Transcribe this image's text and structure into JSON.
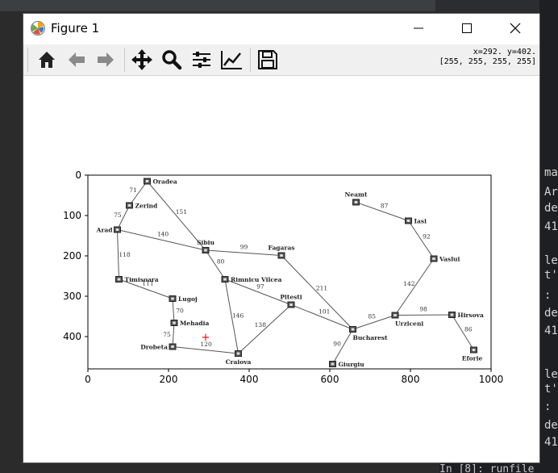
{
  "window": {
    "title": "Figure 1"
  },
  "toolbar": {
    "buttons": [
      "home-icon",
      "back-arrow-icon",
      "forward-arrow-icon",
      "pan-icon",
      "zoom-icon",
      "configure-subplots-icon",
      "edit-axis-icon",
      "save-icon"
    ],
    "coords_line1": "x=292. y=402.",
    "coords_line2": "[255, 255, 255, 255]"
  },
  "background_code": {
    "lines": [
      "ma",
      "Ar",
      "de",
      "41",
      "le",
      "t')",
      ": A",
      "de",
      "41",
      "le",
      "t')",
      ": A",
      "de",
      "41"
    ],
    "bottom": "In [8]: runfile"
  },
  "chart_data": {
    "type": "scatter",
    "description_kind": "romania map image shown with imshow",
    "xlim": [
      0,
      1000
    ],
    "ylim": [
      480,
      0
    ],
    "xticks": [
      0,
      200,
      400,
      600,
      800,
      1000
    ],
    "yticks": [
      0,
      100,
      200,
      300,
      400
    ],
    "cities": [
      {
        "name": "Oradea",
        "x": 147,
        "y": 15
      },
      {
        "name": "Zerind",
        "x": 103,
        "y": 75
      },
      {
        "name": "Arad",
        "x": 73,
        "y": 135
      },
      {
        "name": "Timisoara",
        "x": 77,
        "y": 258
      },
      {
        "name": "Lugoj",
        "x": 210,
        "y": 306
      },
      {
        "name": "Mehadia",
        "x": 214,
        "y": 366
      },
      {
        "name": "Drobeta",
        "x": 210,
        "y": 425
      },
      {
        "name": "Craiova",
        "x": 373,
        "y": 442
      },
      {
        "name": "Sibiu",
        "x": 292,
        "y": 186
      },
      {
        "name": "Rimnicu Vilcea",
        "x": 340,
        "y": 258
      },
      {
        "name": "Fagaras",
        "x": 480,
        "y": 199
      },
      {
        "name": "Pitesti",
        "x": 504,
        "y": 321
      },
      {
        "name": "Bucharest",
        "x": 657,
        "y": 382
      },
      {
        "name": "Giurgiu",
        "x": 607,
        "y": 468
      },
      {
        "name": "Urziceni",
        "x": 762,
        "y": 347
      },
      {
        "name": "Hirsova",
        "x": 903,
        "y": 346
      },
      {
        "name": "Eforie",
        "x": 957,
        "y": 433
      },
      {
        "name": "Vaslui",
        "x": 858,
        "y": 207
      },
      {
        "name": "Iasi",
        "x": 795,
        "y": 113
      },
      {
        "name": "Neamt",
        "x": 665,
        "y": 67
      }
    ],
    "roads": [
      {
        "a": "Oradea",
        "b": "Zerind",
        "d": "71"
      },
      {
        "a": "Zerind",
        "b": "Arad",
        "d": "75"
      },
      {
        "a": "Arad",
        "b": "Sibiu",
        "d": "140"
      },
      {
        "a": "Oradea",
        "b": "Sibiu",
        "d": "151"
      },
      {
        "a": "Arad",
        "b": "Timisoara",
        "d": "118"
      },
      {
        "a": "Timisoara",
        "b": "Lugoj",
        "d": "111"
      },
      {
        "a": "Lugoj",
        "b": "Mehadia",
        "d": "70"
      },
      {
        "a": "Mehadia",
        "b": "Drobeta",
        "d": "75"
      },
      {
        "a": "Drobeta",
        "b": "Craiova",
        "d": "120"
      },
      {
        "a": "Sibiu",
        "b": "Fagaras",
        "d": "99"
      },
      {
        "a": "Sibiu",
        "b": "Rimnicu Vilcea",
        "d": "80"
      },
      {
        "a": "Rimnicu Vilcea",
        "b": "Pitesti",
        "d": "97"
      },
      {
        "a": "Rimnicu Vilcea",
        "b": "Craiova",
        "d": "146"
      },
      {
        "a": "Craiova",
        "b": "Pitesti",
        "d": "138"
      },
      {
        "a": "Pitesti",
        "b": "Bucharest",
        "d": "101"
      },
      {
        "a": "Fagaras",
        "b": "Bucharest",
        "d": "211"
      },
      {
        "a": "Bucharest",
        "b": "Giurgiu",
        "d": "90"
      },
      {
        "a": "Bucharest",
        "b": "Urziceni",
        "d": "85"
      },
      {
        "a": "Urziceni",
        "b": "Hirsova",
        "d": "98"
      },
      {
        "a": "Hirsova",
        "b": "Eforie",
        "d": "86"
      },
      {
        "a": "Urziceni",
        "b": "Vaslui",
        "d": "142"
      },
      {
        "a": "Vaslui",
        "b": "Iasi",
        "d": "92"
      },
      {
        "a": "Iasi",
        "b": "Neamt",
        "d": "87"
      }
    ],
    "marker": {
      "x": 292,
      "y": 402,
      "symbol": "+",
      "color": "#e00000"
    }
  }
}
